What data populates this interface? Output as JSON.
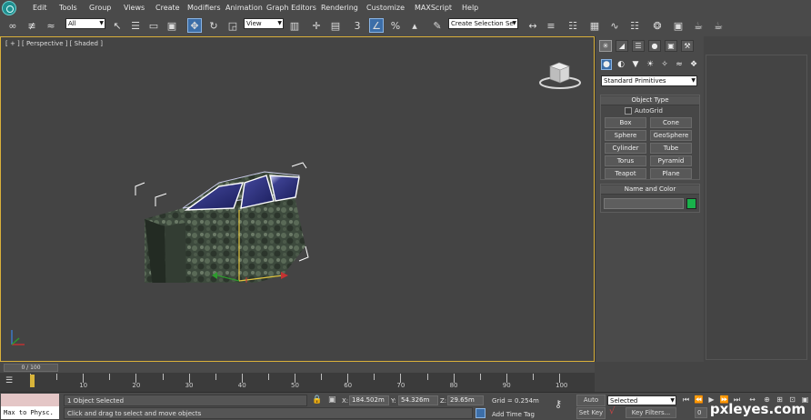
{
  "menubar": {
    "items": [
      "Edit",
      "Tools",
      "Group",
      "Views",
      "Create",
      "Modifiers",
      "Animation",
      "Graph Editors",
      "Rendering",
      "Customize",
      "MAXScript",
      "Help"
    ]
  },
  "toolbar": {
    "selection_filter": "All",
    "reference_coord": "View",
    "snap_number": "3",
    "named_selection": "Create Selection Se"
  },
  "viewport": {
    "label": "[ + ] [ Perspective ] [ Shaded ]"
  },
  "command_panel": {
    "category": "Standard Primitives",
    "object_type_title": "Object Type",
    "autogrid_label": "AutoGrid",
    "buttons": [
      "Box",
      "Cone",
      "Sphere",
      "GeoSphere",
      "Cylinder",
      "Tube",
      "Torus",
      "Pyramid",
      "Teapot",
      "Plane"
    ],
    "name_color_title": "Name and Color",
    "name_value": "",
    "color_swatch": "#19b24b"
  },
  "timeline": {
    "frame_display": "0 / 100",
    "ticks": [
      "10",
      "20",
      "30",
      "40",
      "50",
      "60",
      "70",
      "80",
      "90",
      "100"
    ]
  },
  "status": {
    "script_listener": "Max to Physc.",
    "selection_count": "1 Object Selected",
    "prompt": "Click and drag to select and move objects",
    "x_label": "X:",
    "x_value": "184.502m",
    "y_label": "Y:",
    "y_value": "54.326m",
    "z_label": "Z:",
    "z_value": "29.65m",
    "grid": "Grid = 0.254m",
    "add_time_tag": "Add Time Tag",
    "auto_key": "Auto Key",
    "set_key": "Set Key",
    "key_mode": "Selected",
    "key_filters": "Key Filters...",
    "frame_field": "0"
  },
  "watermark": "pxleyes.com",
  "colors": {
    "viewport_border": "#d9b03a",
    "active_button": "#3c6ea8"
  }
}
